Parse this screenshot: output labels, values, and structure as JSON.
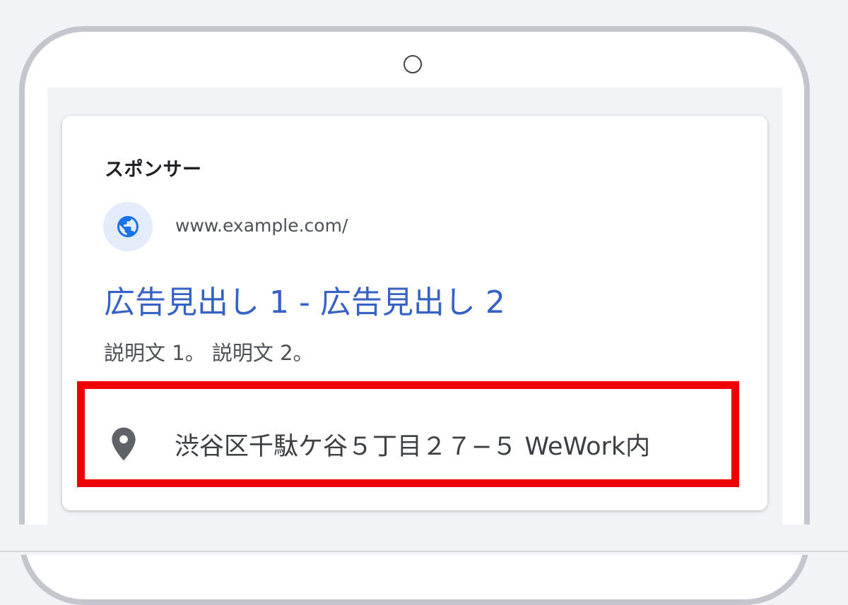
{
  "ad": {
    "sponsor_label": "スポンサー",
    "url": "www.example.com/",
    "headline": "広告見出し 1 - 広告見出し 2",
    "description": "説明文 1。 説明文 2。",
    "address": "渋谷区千駄ケ谷５丁目２７−５ WeWork内"
  },
  "icons": {
    "favicon": "globe-icon",
    "location": "map-pin-icon"
  },
  "colors": {
    "headline_link": "#3562c4",
    "highlight_border": "#ef0000",
    "favicon_background": "#e4ecfb",
    "favicon_globe": "#1a73e8",
    "location_pin": "#5f6368"
  }
}
